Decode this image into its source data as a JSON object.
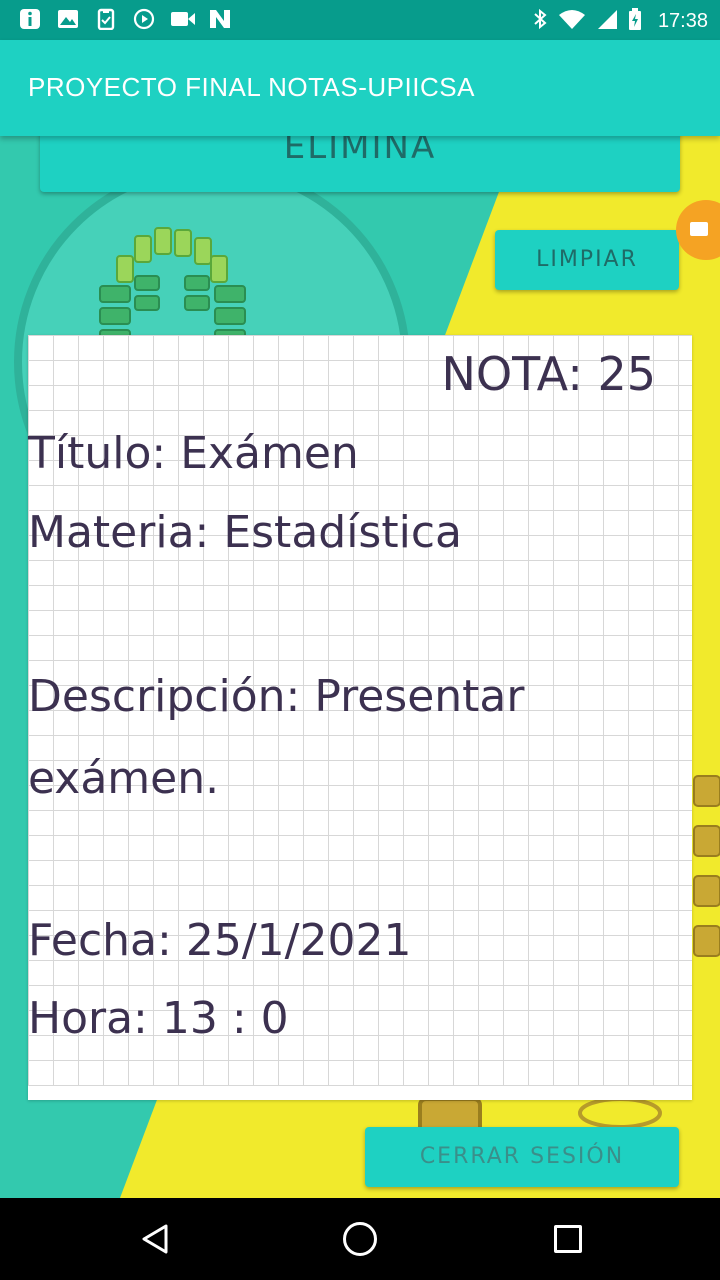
{
  "status_bar": {
    "time": "17:38",
    "left_icons": [
      "info-icon",
      "image-icon",
      "clipboard-icon",
      "play-icon",
      "video-icon",
      "n-app-icon"
    ],
    "right_icons": [
      "bluetooth-icon",
      "wifi-icon",
      "signal-icon",
      "battery-icon"
    ]
  },
  "app_bar": {
    "title": "PROYECTO FINAL NOTAS-UPIICSA"
  },
  "buttons": {
    "elimina": "ELIMINA",
    "limpiar": "LIMPIAR",
    "cerrar_sesion": "CERRAR SESIÓN"
  },
  "note": {
    "nota": "NOTA: 25",
    "titulo": "Título: Exámen",
    "materia": "Materia: Estadística",
    "descripcion_line1": "Descripción: Presentar",
    "descripcion_line2": "exámen.",
    "fecha": "Fecha: 25/1/2021",
    "hora": "Hora: 13 : 0"
  },
  "colors": {
    "status_bar": "#079c8c",
    "app_bar": "#1ed1c2",
    "background_yellow": "#f1ea2c",
    "background_teal": "#33c9ae",
    "note_text": "#3c3150"
  }
}
